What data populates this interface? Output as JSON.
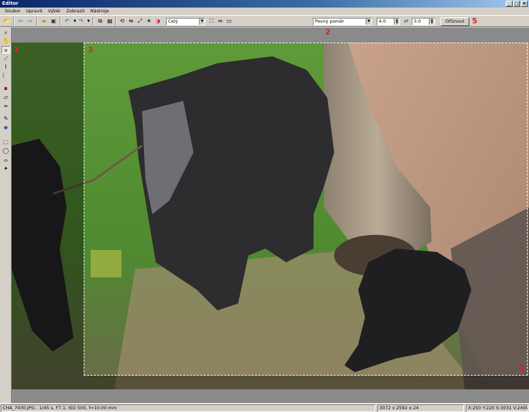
{
  "window": {
    "title": "Editor"
  },
  "menu": [
    "Soubor",
    "Upravit",
    "Výběr",
    "Zobrazit",
    "Nástroje"
  ],
  "toolbar": {
    "zoom_value": "Celý",
    "aspect_mode": "Pevný poměr",
    "ratio_width": "4.0",
    "ratio_height": "3.0",
    "crop_button": "Oříznout"
  },
  "markers": [
    "1",
    "2",
    "3",
    "4",
    "5"
  ],
  "statusbar": {
    "file_info": "CHA_7930.JPG - 1/45 s, F7.1, ISO 500, f=10.00 mm",
    "dimensions": "3072 x 2592 x 24",
    "coords": "X:250  Y:220  S:3031  V:2499"
  },
  "colors": {
    "marker": "#e02020",
    "titlebar": "#0a246a",
    "chrome": "#d4d0c8"
  },
  "icons": [
    "new-icon",
    "back-icon",
    "forward-icon",
    "open-icon",
    "save-icon",
    "undo-icon",
    "redo-icon",
    "copy-icon",
    "paste-icon",
    "rotate-icon",
    "flip-icon",
    "resize-icon",
    "brightness-icon",
    "color-icon",
    "fit-icon",
    "width-icon",
    "actual-size-icon",
    "zoom-icon",
    "hand-icon",
    "crop-icon",
    "line-icon",
    "text-icon",
    "stamp-icon",
    "eraser-icon",
    "brush-icon",
    "fill-icon",
    "select-icon",
    "lasso-icon",
    "wand-icon"
  ]
}
